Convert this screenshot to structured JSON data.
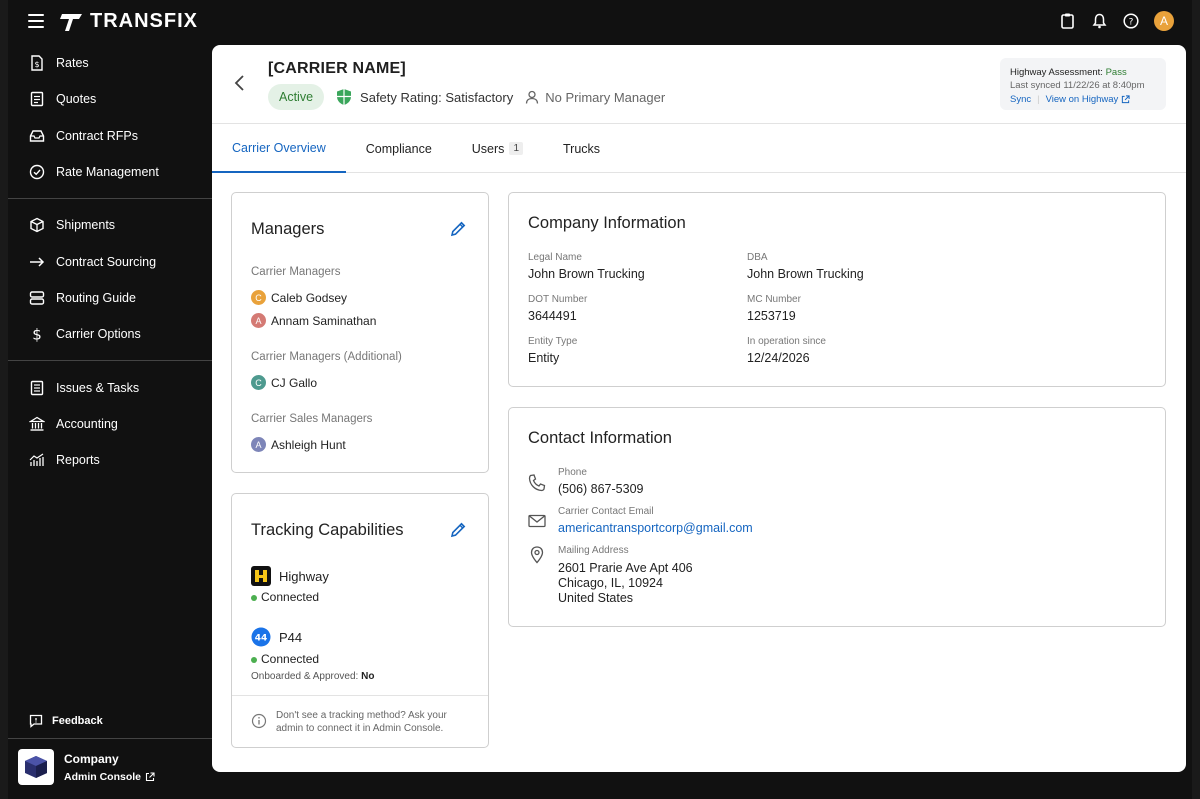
{
  "app": {
    "logo_text": "TRANSFIX",
    "avatar_initial": "A"
  },
  "sidebar": {
    "groups": [
      [
        {
          "label": "Rates",
          "icon": "rates-icon"
        },
        {
          "label": "Quotes",
          "icon": "quotes-icon"
        },
        {
          "label": "Contract RFPs",
          "icon": "inbox-icon"
        },
        {
          "label": "Rate Management",
          "icon": "check-circle-icon"
        }
      ],
      [
        {
          "label": "Shipments",
          "icon": "box-icon"
        },
        {
          "label": "Contract Sourcing",
          "icon": "arrow-right-icon"
        },
        {
          "label": "Routing Guide",
          "icon": "server-icon"
        },
        {
          "label": "Carrier Options",
          "icon": "dollar-icon"
        }
      ],
      [
        {
          "label": "Issues & Tasks",
          "icon": "list-icon"
        },
        {
          "label": "Accounting",
          "icon": "bank-icon"
        },
        {
          "label": "Reports",
          "icon": "chart-icon"
        }
      ]
    ],
    "feedback_label": "Feedback",
    "company_name": "Company",
    "admin_console_label": "Admin Console"
  },
  "header": {
    "carrier_name": "[CARRIER NAME]",
    "status_badge": "Active",
    "safety_rating": "Safety Rating: Satisfactory",
    "primary_manager": "No Primary Manager",
    "highway": {
      "title": "Highway Assessment:",
      "result": "Pass",
      "last_synced": "Last synced 11/22/26 at 8:40pm",
      "sync_label": "Sync",
      "view_label": "View on Highway"
    }
  },
  "tabs": [
    {
      "label": "Carrier Overview",
      "active": true
    },
    {
      "label": "Compliance"
    },
    {
      "label": "Users",
      "count": "1"
    },
    {
      "label": "Trucks"
    }
  ],
  "managers": {
    "title": "Managers",
    "sections": [
      {
        "label": "Carrier Managers",
        "people": [
          {
            "initial": "C",
            "name": "Caleb Godsey",
            "color": "#e9a23b"
          },
          {
            "initial": "A",
            "name": "Annam Saminathan",
            "color": "#d47a74"
          }
        ]
      },
      {
        "label": "Carrier Managers (Additional)",
        "people": [
          {
            "initial": "C",
            "name": "CJ Gallo",
            "color": "#4e9a8f"
          }
        ]
      },
      {
        "label": "Carrier Sales Managers",
        "people": [
          {
            "initial": "A",
            "name": "Ashleigh Hunt",
            "color": "#7d85b8"
          }
        ]
      }
    ]
  },
  "tracking": {
    "title": "Tracking Capabilities",
    "highway_name": "Highway",
    "highway_status": "Connected",
    "p44_name": "P44",
    "p44_status": "Connected",
    "onboarded_label": "Onboarded & Approved:",
    "onboarded_value": "No",
    "note": "Don't see a tracking method? Ask your admin to connect it in Admin Console."
  },
  "company_info": {
    "title": "Company Information",
    "legal_name_label": "Legal Name",
    "legal_name": "John Brown Trucking",
    "dba_label": "DBA",
    "dba": "John Brown Trucking",
    "dot_label": "DOT Number",
    "dot": "3644491",
    "mc_label": "MC Number",
    "mc": "1253719",
    "entity_label": "Entity Type",
    "entity": "Entity",
    "since_label": "In operation since",
    "since": "12/24/2026"
  },
  "contact_info": {
    "title": "Contact Information",
    "phone_label": "Phone",
    "phone": "(506) 867-5309",
    "email_label": "Carrier Contact Email",
    "email": "americantransportcorp@gmail.com",
    "address_label": "Mailing Address",
    "address_line1": "2601 Prarie Ave Apt 406",
    "address_line2": "Chicago, IL, 10924",
    "address_line3": "United States"
  },
  "colors": {
    "accent": "#1565c0",
    "active_green": "#2e7d32",
    "sidebar_bg": "#111111"
  }
}
